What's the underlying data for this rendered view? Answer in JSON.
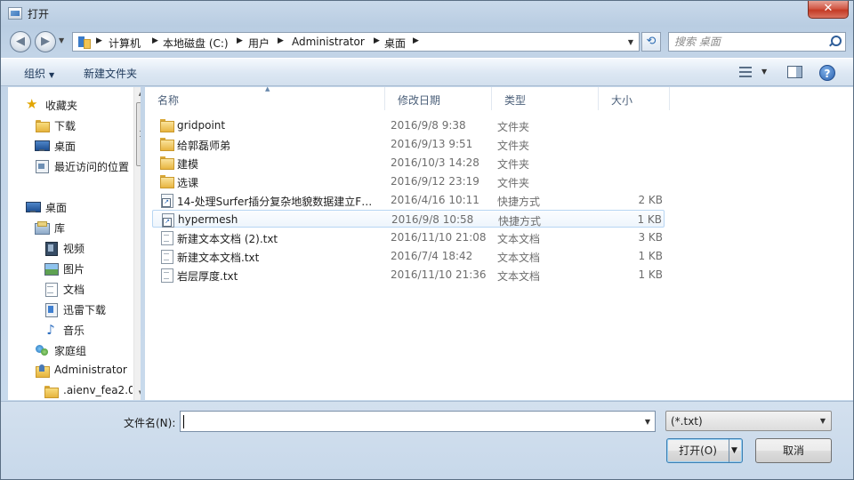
{
  "window": {
    "title": "打开",
    "close_label": "✕"
  },
  "nav": {
    "back_icon": "back-arrow-icon",
    "forward_icon": "forward-arrow-icon"
  },
  "address": {
    "segments": [
      "计算机",
      "本地磁盘 (C:)",
      "用户",
      "Administrator",
      "桌面"
    ]
  },
  "search": {
    "placeholder": "搜索 桌面"
  },
  "toolbar": {
    "organize_label": "组织",
    "new_folder_label": "新建文件夹"
  },
  "sidebar": {
    "items": [
      {
        "label": "收藏夹",
        "icon": "star-icon"
      },
      {
        "label": "下载",
        "icon": "folder-icon"
      },
      {
        "label": "桌面",
        "icon": "desktop-icon"
      },
      {
        "label": "最近访问的位置",
        "icon": "recent-places-icon"
      },
      {
        "label": "桌面",
        "icon": "desktop-icon"
      },
      {
        "label": "库",
        "icon": "library-icon"
      },
      {
        "label": "视频",
        "icon": "video-icon"
      },
      {
        "label": "图片",
        "icon": "picture-icon"
      },
      {
        "label": "文档",
        "icon": "document-icon"
      },
      {
        "label": "迅雷下载",
        "icon": "xunlei-icon"
      },
      {
        "label": "音乐",
        "icon": "music-icon"
      },
      {
        "label": "家庭组",
        "icon": "homegroup-icon"
      },
      {
        "label": "Administrator",
        "icon": "user-folder-icon"
      },
      {
        "label": ".aienv_fea2.0",
        "icon": "folder-icon"
      }
    ]
  },
  "columns": {
    "name": "名称",
    "modified": "修改日期",
    "type": "类型",
    "size": "大小"
  },
  "files": [
    {
      "name": "gridpoint",
      "modified": "2016/9/8 9:38",
      "type": "文件夹",
      "size": "",
      "kind": "folder"
    },
    {
      "name": "给郭磊师弟",
      "modified": "2016/9/13 9:51",
      "type": "文件夹",
      "size": "",
      "kind": "folder"
    },
    {
      "name": "建模",
      "modified": "2016/10/3 14:28",
      "type": "文件夹",
      "size": "",
      "kind": "folder"
    },
    {
      "name": "选课",
      "modified": "2016/9/12 23:19",
      "type": "文件夹",
      "size": "",
      "kind": "folder"
    },
    {
      "name": "14-处理Surfer插分复杂地貌数据建立FL...",
      "modified": "2016/4/16 10:11",
      "type": "快捷方式",
      "size": "2 KB",
      "kind": "shortcut"
    },
    {
      "name": "hypermesh",
      "modified": "2016/9/8 10:58",
      "type": "快捷方式",
      "size": "1 KB",
      "kind": "shortcut"
    },
    {
      "name": "新建文本文档 (2).txt",
      "modified": "2016/11/10 21:08",
      "type": "文本文档",
      "size": "3 KB",
      "kind": "txt"
    },
    {
      "name": "新建文本文档.txt",
      "modified": "2016/7/4 18:42",
      "type": "文本文档",
      "size": "1 KB",
      "kind": "txt"
    },
    {
      "name": "岩层厚度.txt",
      "modified": "2016/11/10 21:36",
      "type": "文本文档",
      "size": "1 KB",
      "kind": "txt"
    }
  ],
  "footer": {
    "filename_label": "文件名(N):",
    "filename_value": "",
    "filter_value": "(*.txt)",
    "open_label": "打开(O)",
    "cancel_label": "取消"
  }
}
